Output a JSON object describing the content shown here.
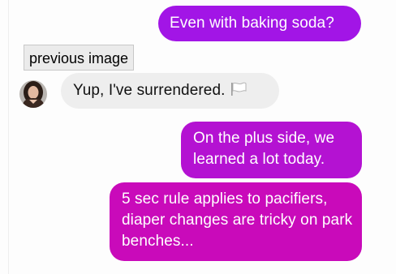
{
  "messages": [
    {
      "direction": "outgoing",
      "text": "Even with baking soda?"
    },
    {
      "direction": "incoming",
      "text": "Yup, I've surrendered.",
      "emoji": "white-flag-icon"
    },
    {
      "direction": "outgoing",
      "text": "On the plus side, we learned a lot today."
    },
    {
      "direction": "outgoing",
      "text": "5 sec rule applies to pacifiers, diaper changes are tricky on park benches..."
    }
  ],
  "tooltip": {
    "text": "previous image"
  },
  "colors": {
    "outgoing_1": "#a215e6",
    "outgoing_2": "#b412d2",
    "outgoing_3": "#c90aba",
    "incoming": "#eeeeee"
  }
}
